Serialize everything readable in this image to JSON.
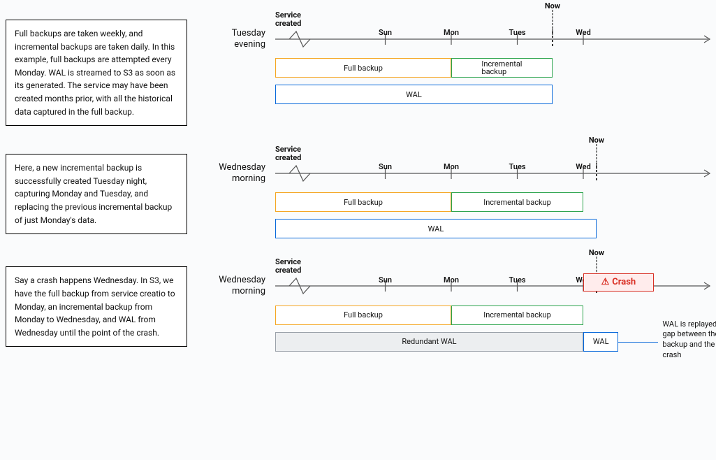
{
  "axis_labels": {
    "service_created": "Service\ncreated",
    "sun": "Sun",
    "mon": "Mon",
    "tues": "Tues",
    "wed": "Wed",
    "now": "Now"
  },
  "bar_labels": {
    "full_backup": "Full backup",
    "incremental_backup": "Incremental backup",
    "incremental_backup_short": "Incremental\nbackup",
    "wal": "WAL",
    "redundant_wal": "Redundant WAL",
    "crash": "Crash"
  },
  "side_note": "WAL is replayed to bridge the gap between the incremental backup and the time of the crash",
  "sections": [
    {
      "title": "Tuesday evening",
      "desc": "Full backups are taken weekly, and incremental backups are taken daily. In this example, full backups are attempted every Monday. WAL is streamed to S3 as soon as its generated. The service may have been created months prior, with all the historical data captured in the full backup."
    },
    {
      "title": "Wednesday morning",
      "desc": "Here, a new incremental backup is successfully  created Tuesday night, capturing Monday and Tuesday, and replacing the previous incremental backup of just Monday's data."
    },
    {
      "title": "Wednesday morning",
      "desc": "Say a crash happens Wednesday. In S3, we have the full backup from service creatio to Monday, an incremental backup from Monday to Wednesday, and WAL from Wednesday until the point of the crash."
    }
  ],
  "chart_data": {
    "type": "timeline",
    "axis": {
      "unit": "percent_of_axis_width",
      "service_created": 0,
      "sun": 25,
      "mon": 40,
      "tues": 55,
      "wed": 70,
      "axis_arrow_end": 100
    },
    "panels": [
      {
        "name": "Tuesday evening",
        "now": 63,
        "bars": [
          {
            "row": 0,
            "label": "Full backup",
            "start": 0,
            "end": 40,
            "color": "orange"
          },
          {
            "row": 0,
            "label": "Incremental backup",
            "start": 40,
            "end": 63,
            "color": "green"
          },
          {
            "row": 1,
            "label": "WAL",
            "start": 0,
            "end": 63,
            "color": "blue"
          }
        ]
      },
      {
        "name": "Wednesday morning",
        "now": 73,
        "bars": [
          {
            "row": 0,
            "label": "Full backup",
            "start": 0,
            "end": 40,
            "color": "orange"
          },
          {
            "row": 0,
            "label": "Incremental backup",
            "start": 40,
            "end": 70,
            "color": "green"
          },
          {
            "row": 1,
            "label": "WAL",
            "start": 0,
            "end": 73,
            "color": "blue"
          }
        ]
      },
      {
        "name": "Wednesday morning (crash)",
        "now": 73,
        "crash": {
          "start": 70,
          "end": 86
        },
        "bars": [
          {
            "row": 0,
            "label": "Full backup",
            "start": 0,
            "end": 40,
            "color": "orange"
          },
          {
            "row": 0,
            "label": "Incremental backup",
            "start": 40,
            "end": 70,
            "color": "green"
          },
          {
            "row": 1,
            "label": "Redundant WAL",
            "start": 0,
            "end": 70,
            "color": "grey"
          },
          {
            "row": 1,
            "label": "WAL",
            "start": 70,
            "end": 78,
            "color": "blue"
          }
        ],
        "annotation": "WAL is replayed to bridge the gap between the incremental backup and the time of the crash"
      }
    ]
  }
}
